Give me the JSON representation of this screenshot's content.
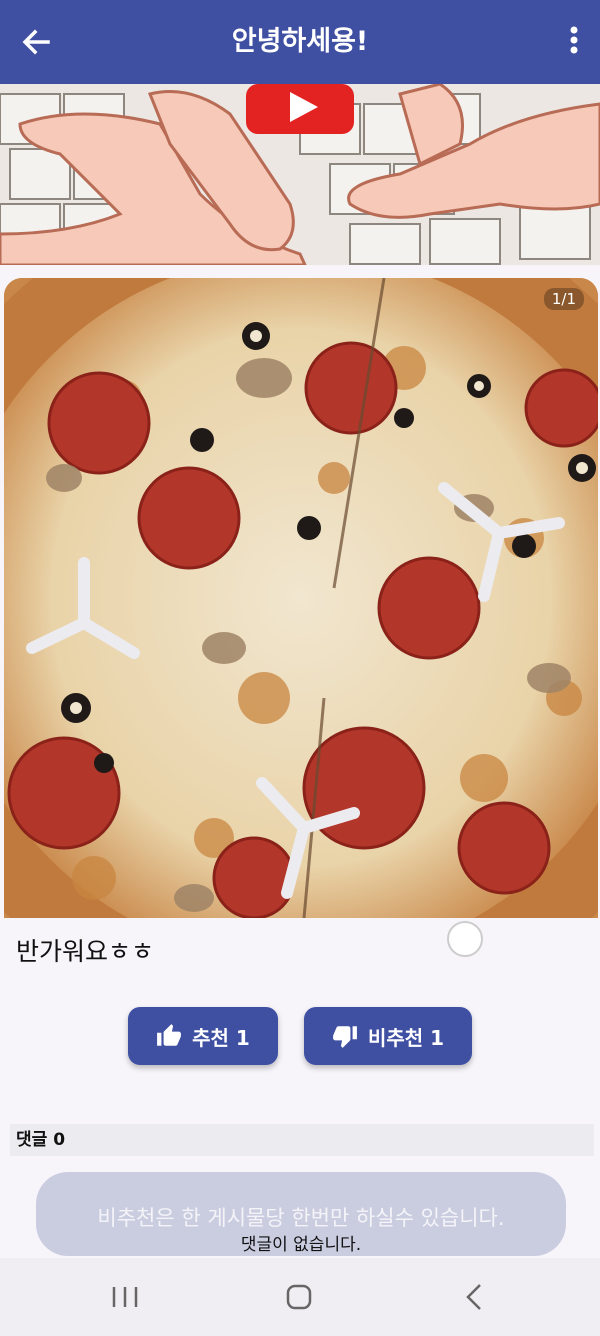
{
  "appbar": {
    "title": "안녕하세용!",
    "back_icon": "arrow-left-icon",
    "menu_icon": "more-vertical-icon"
  },
  "video": {
    "thumbnail": "anime hands typing on keyboard",
    "play_icon": "youtube-play-icon"
  },
  "photo": {
    "subject": "pepperoni pizza",
    "pager": "1/1"
  },
  "post": {
    "text": "반가워요ㅎㅎ"
  },
  "votes": {
    "like_label": "추천 1",
    "dislike_label": "비추천 1"
  },
  "comments": {
    "header": "댓글 0",
    "empty_text": "댓글이 없습니다."
  },
  "toast": {
    "message": "비추천은 한 게시물당 한번만 하실수 있습니다."
  },
  "navbar": {
    "recents_icon": "recents-icon",
    "home_icon": "home-icon",
    "back_icon": "back-chevron-icon"
  },
  "colors": {
    "primary": "#3f4fa2",
    "toast_bg": "#cacde0",
    "background": "#f7f5fa"
  }
}
